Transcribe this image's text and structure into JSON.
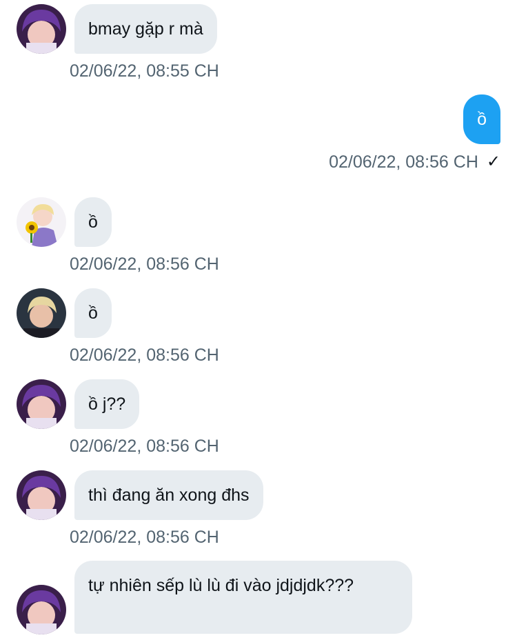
{
  "messages": [
    {
      "text": "bmay gặp r mà",
      "time": "02/06/22, 08:55 CH",
      "direction": "in",
      "avatar": "avatar-purple-hair"
    },
    {
      "text": "ồ",
      "time": "02/06/22, 08:56 CH",
      "direction": "out",
      "status_icon": "✓"
    },
    {
      "text": "ồ",
      "time": "02/06/22, 08:56 CH",
      "direction": "in",
      "avatar": "avatar-sunflower"
    },
    {
      "text": "ồ",
      "time": "02/06/22, 08:56 CH",
      "direction": "in",
      "avatar": "avatar-blonde"
    },
    {
      "text": "ồ j??",
      "time": "02/06/22, 08:56 CH",
      "direction": "in",
      "avatar": "avatar-purple-hair"
    },
    {
      "text": "thì đang ăn xong đhs",
      "time": "02/06/22, 08:56 CH",
      "direction": "in",
      "avatar": "avatar-purple-hair"
    },
    {
      "text": "tự nhiên sếp lù lù đi vào jdjdjdk???",
      "direction": "in",
      "avatar": "avatar-purple-hair"
    }
  ],
  "colors": {
    "incoming_bubble": "#e7ecf0",
    "outgoing_bubble": "#1da1f2",
    "timestamp": "#536471"
  }
}
